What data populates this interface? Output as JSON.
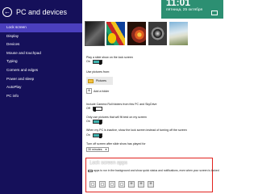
{
  "sidebar": {
    "back_glyph": "←",
    "title": "PC and devices",
    "items": [
      {
        "label": "Lock screen",
        "active": true
      },
      {
        "label": "Display"
      },
      {
        "label": "Devices"
      },
      {
        "label": "Mouse and touchpad"
      },
      {
        "label": "Typing"
      },
      {
        "label": "Corners and edges"
      },
      {
        "label": "Power and sleep"
      },
      {
        "label": "AutoPlay"
      },
      {
        "label": "PC info"
      }
    ]
  },
  "preview": {
    "time": "11:01",
    "date": "пятница, 25 октября"
  },
  "settings": {
    "slideshow_label": "Play a slide show on the lock screen",
    "slideshow_state": "On",
    "use_pictures_from": "Use pictures from:",
    "folder_name": "Pictures",
    "add_folder": "Add a folder",
    "include_camera_roll": "Include Camera Roll folders from this PC and SkyDrive",
    "include_camera_roll_state": "Off",
    "only_fit_pictures": "Only use pictures that will fit best on my screen",
    "only_fit_pictures_state": "On",
    "inactive_show": "When my PC is inactive, show the lock screen instead of turning off the screen",
    "inactive_show_state": "On",
    "turn_off_screen": "Turn off screen after slide show has played for",
    "duration": "30 minutes"
  },
  "lock_apps": {
    "title": "Lock screen apps",
    "description": "apps to run in the background and show quick status and notifications, even when your screen is locked"
  },
  "colors": {
    "sidebar_bg": "#15105a",
    "sidebar_active": "#4b3fbe",
    "toggle_accent": "#3fb3b0",
    "highlight": "#e1231f"
  }
}
